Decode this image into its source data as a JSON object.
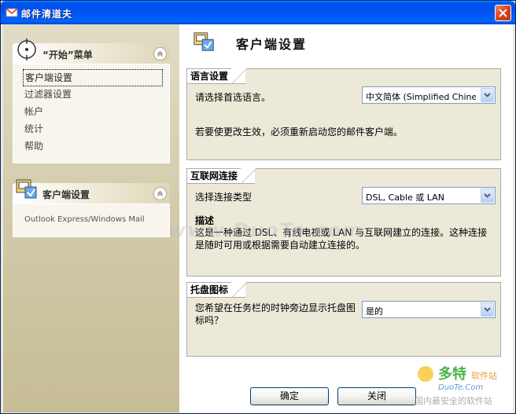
{
  "window": {
    "title": "邮件清道夫"
  },
  "sidebar": {
    "sections": [
      {
        "title": "“开始”菜单",
        "items": [
          "客户端设置",
          "过滤器设置",
          "帐户",
          "统计",
          "帮助"
        ]
      },
      {
        "title": "客户端设置",
        "items": [
          "Outlook Express/Windows Mail"
        ]
      }
    ]
  },
  "page": {
    "title": "客户端设置"
  },
  "groups": {
    "language": {
      "title": "语言设置",
      "label": "请选择首选语言。",
      "value": "中文简体 (Simplified Chine…",
      "note": "若要使更改生效，必须重新启动您的邮件客户端。"
    },
    "internet": {
      "title": "互联网连接",
      "label": "选择连接类型",
      "value": "DSL, Cable 或 LAN",
      "desc_title": "描述",
      "desc_line1": "这是一种通过 DSL、有线电视或 LAN 与互联网建立的连接。这种连接",
      "desc_line2": "是随时可用或根据需要自动建立连接的。"
    },
    "tray": {
      "title": "托盘图标",
      "label_line1": "您希望在任务栏的时钟旁边显示托盘图",
      "label_line2": "标吗？",
      "value": "是的"
    }
  },
  "buttons": {
    "ok": "确定",
    "close": "关闭"
  },
  "watermark": {
    "text": "www.DuoTe.com"
  },
  "corner_logo": {
    "cn": "多特",
    "sub": "软件站",
    "en": "DuoTe.Com",
    "tag": "国内最安全的软件站"
  },
  "colors": {
    "titlebar": "#0053ee",
    "close": "#d8431a",
    "panel": "#ece9d8",
    "sidebar": "#cfc7a5"
  }
}
